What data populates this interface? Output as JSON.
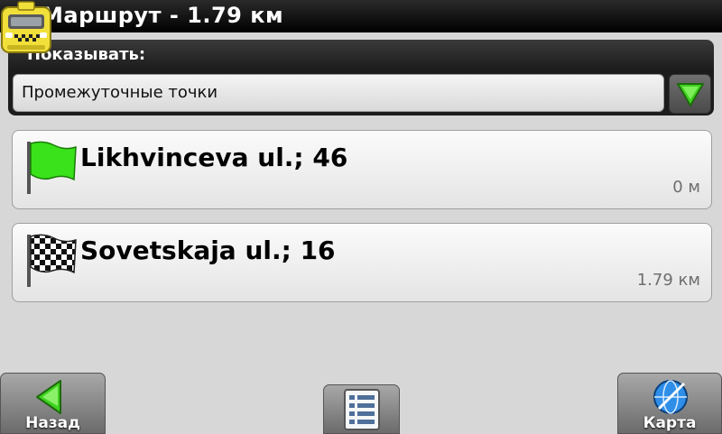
{
  "header": {
    "title": "Маршрут - 1.79 км",
    "app_icon": "taxi-icon"
  },
  "filter": {
    "label": "Показывать:",
    "selected": "Промежуточные точки",
    "dropdown_icon": "triangle-down-icon"
  },
  "waypoints": [
    {
      "name": "Likhvinceva ul.; 46",
      "distance": "0 м",
      "icon": "green-flag-icon"
    },
    {
      "name": "Sovetskaja ul.; 16",
      "distance": "1.79 км",
      "icon": "checkered-flag-icon"
    }
  ],
  "bottom_bar": {
    "back_label": "Назад",
    "list_icon": "list-icon",
    "map_label": "Карта"
  },
  "colors": {
    "accent_green": "#3fd21f",
    "title_bar": "#000000",
    "panel_bg": "#d7d7d7"
  }
}
